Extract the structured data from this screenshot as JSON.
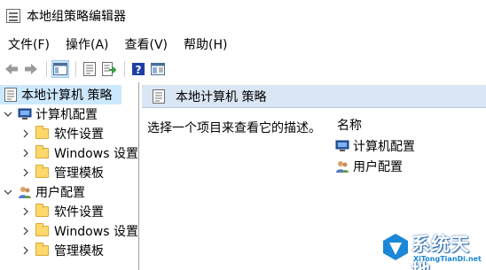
{
  "window": {
    "title": "本地组策略编辑器"
  },
  "menu": [
    {
      "label": "文件(F)"
    },
    {
      "label": "操作(A)"
    },
    {
      "label": "查看(V)"
    },
    {
      "label": "帮助(H)"
    }
  ],
  "toolbar": {
    "icons": [
      "back-arrow-icon",
      "forward-arrow-icon",
      "show-hide-tree-icon",
      "properties-icon",
      "export-list-icon",
      "help-icon",
      "extended-view-icon"
    ]
  },
  "tree": {
    "root": "本地计算机 策略",
    "computer_config": "计算机配置",
    "computer_children": [
      "软件设置",
      "Windows 设置",
      "管理模板"
    ],
    "user_config": "用户配置",
    "user_children": [
      "软件设置",
      "Windows 设置",
      "管理模板"
    ]
  },
  "details": {
    "header": "本地计算机 策略",
    "description": "选择一个项目来查看它的描述。",
    "column_name": "名称",
    "items": [
      "计算机配置",
      "用户配置"
    ]
  },
  "watermark": {
    "text": "系统天地",
    "url_text": "XiTongTianDi.net"
  },
  "colors": {
    "selection": "#cce8ff",
    "header_bg": "#dbe6f4",
    "folder": "#ffd86b"
  }
}
